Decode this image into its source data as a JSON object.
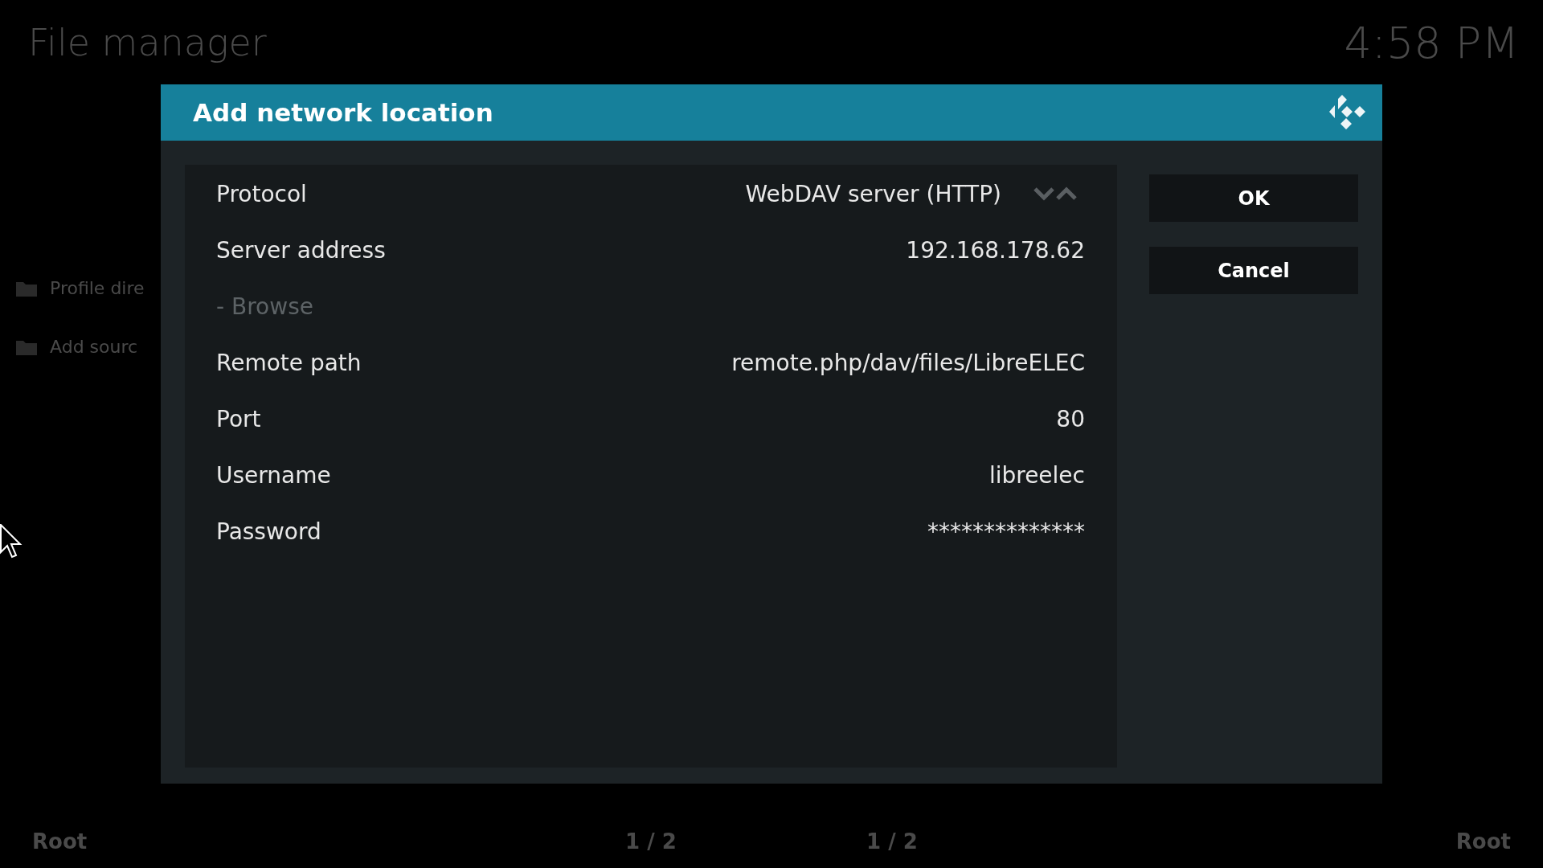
{
  "background": {
    "title": "File manager",
    "clock": "4:58 PM",
    "list": [
      {
        "label": "Profile dire"
      },
      {
        "label": "Add sourc"
      }
    ],
    "footer": {
      "left": "Root",
      "page_left": "1 / 2",
      "page_right": "1 / 2",
      "right": "Root"
    }
  },
  "dialog": {
    "title": "Add network location",
    "rows": [
      {
        "kind": "spinner",
        "label": "Protocol",
        "value": "WebDAV server (HTTP)",
        "disabled": false
      },
      {
        "kind": "value",
        "label": "Server address",
        "value": "192.168.178.62",
        "disabled": false
      },
      {
        "kind": "action",
        "label": "- Browse",
        "disabled": true
      },
      {
        "kind": "value",
        "label": "Remote path",
        "value": "remote.php/dav/files/LibreELEC",
        "disabled": false
      },
      {
        "kind": "value",
        "label": "Port",
        "value": "80",
        "disabled": false
      },
      {
        "kind": "value",
        "label": "Username",
        "value": "libreelec",
        "disabled": false
      },
      {
        "kind": "value",
        "label": "Password",
        "value": "**************",
        "disabled": false
      }
    ],
    "buttons": [
      "OK",
      "Cancel"
    ]
  }
}
